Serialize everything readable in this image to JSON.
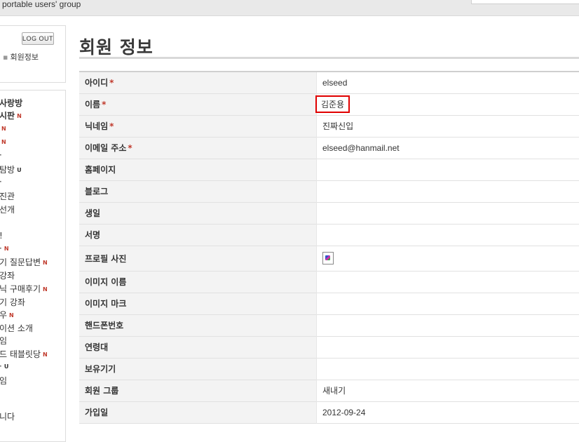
{
  "header": {
    "site_tagline": "portable users' group"
  },
  "sidebar": {
    "logout_label": "LOG OUT",
    "member_info_link": "회원정보",
    "menu_items": [
      {
        "label": "사랑방",
        "bold": true,
        "badge": ""
      },
      {
        "label": "시판",
        "bold": true,
        "badge": "N"
      },
      {
        "label": "",
        "badge": "N"
      },
      {
        "label": "",
        "badge": "N"
      },
      {
        "label": "·",
        "badge": ""
      },
      {
        "label": "탐방",
        "badge": "U"
      },
      {
        "label": "·",
        "badge": ""
      },
      {
        "label": "진관",
        "badge": ""
      },
      {
        "label": "선개",
        "badge": ""
      },
      {
        "label": "",
        "badge": ""
      },
      {
        "label": "!",
        "badge": ""
      },
      {
        "label": "·",
        "badge": "N"
      },
      {
        "label": "기 질문답변",
        "badge": "N"
      },
      {
        "label": "강좌",
        "badge": ""
      },
      {
        "label": "닉 구매후기",
        "badge": "N"
      },
      {
        "label": "기 강좌",
        "badge": ""
      },
      {
        "label": "우",
        "badge": "N"
      },
      {
        "label": "이션 소개",
        "badge": ""
      },
      {
        "label": "임",
        "badge": ""
      },
      {
        "label": "드 태블릿당",
        "badge": "N"
      },
      {
        "label": "·",
        "badge": "U"
      },
      {
        "label": "임",
        "badge": ""
      },
      {
        "label": "",
        "badge": ""
      },
      {
        "label": "니다",
        "badge": ""
      }
    ]
  },
  "main": {
    "title": "회원 정보",
    "rows": [
      {
        "label": "아이디",
        "required": true,
        "value": "elseed"
      },
      {
        "label": "이름",
        "required": true,
        "value": "김준용",
        "highlighted": true
      },
      {
        "label": "닉네임",
        "required": true,
        "value": "진짜신입"
      },
      {
        "label": "이메일 주소",
        "required": true,
        "value": "elseed@hanmail.net"
      },
      {
        "label": "홈페이지",
        "required": false,
        "value": ""
      },
      {
        "label": "블로그",
        "required": false,
        "value": ""
      },
      {
        "label": "생일",
        "required": false,
        "value": ""
      },
      {
        "label": "서명",
        "required": false,
        "value": ""
      },
      {
        "label": "프로필 사진",
        "required": false,
        "value": "",
        "image_icon": "broken-image-icon"
      },
      {
        "label": "이미지 이름",
        "required": false,
        "value": ""
      },
      {
        "label": "이미지 마크",
        "required": false,
        "value": ""
      },
      {
        "label": "핸드폰번호",
        "required": false,
        "value": ""
      },
      {
        "label": "연령대",
        "required": false,
        "value": ""
      },
      {
        "label": "보유기기",
        "required": false,
        "value": ""
      },
      {
        "label": "회원 그룹",
        "required": false,
        "value": "새내기"
      },
      {
        "label": "가입일",
        "required": false,
        "value": "2012-09-24"
      }
    ],
    "required_mark": "*",
    "highlight_color": "#e00000"
  }
}
